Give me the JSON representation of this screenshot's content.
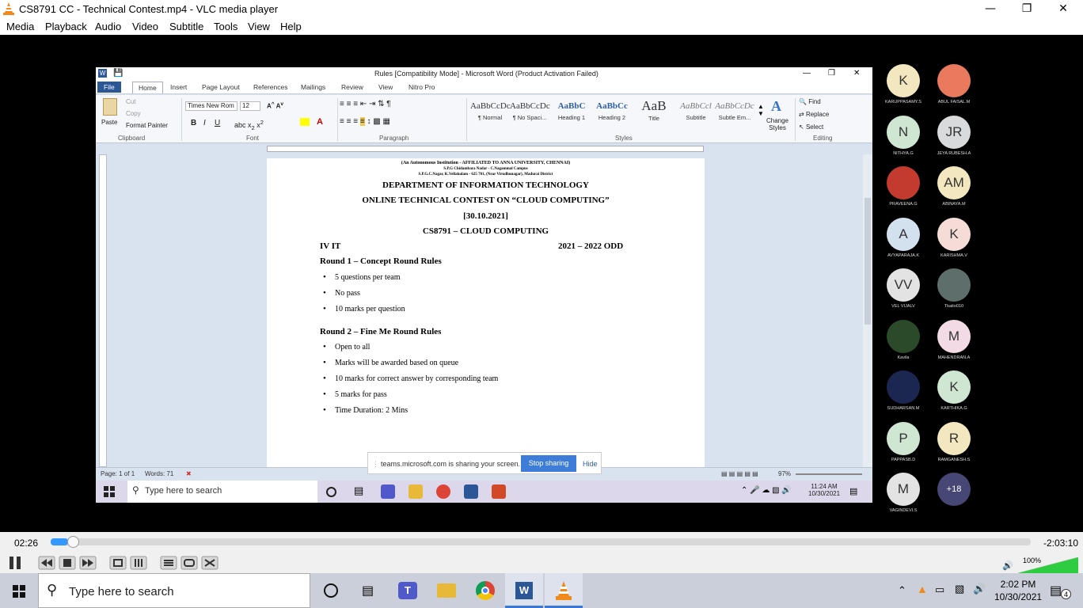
{
  "vlc": {
    "title": "CS8791 CC - Technical Contest.mp4 - VLC media player",
    "menu": [
      "Media",
      "Playback",
      "Audio",
      "Video",
      "Subtitle",
      "Tools",
      "View",
      "Help"
    ],
    "time_elapsed": "02:26",
    "time_remaining": "-2:03:10",
    "progress": 0.018,
    "volume_label": "100%",
    "volume": 1.0
  },
  "word": {
    "title": "Rules [Compatibility Mode] - Microsoft Word (Product Activation Failed)",
    "tabs": [
      "File",
      "Home",
      "Insert",
      "Page Layout",
      "References",
      "Mailings",
      "Review",
      "View",
      "Nitro Pro"
    ],
    "clipboard": {
      "paste": "Paste",
      "cut": "Cut",
      "copy": "Copy",
      "format_painter": "Format Painter",
      "group": "Clipboard"
    },
    "font": {
      "name": "Times New Rom",
      "size": "12",
      "group": "Font"
    },
    "paragraph_group": "Paragraph",
    "styles": [
      {
        "preview": "AaBbCcDc",
        "name": "¶ Normal"
      },
      {
        "preview": "AaBbCcDc",
        "name": "¶ No Spaci..."
      },
      {
        "preview": "AaBbC",
        "name": "Heading 1"
      },
      {
        "preview": "AaBbCc",
        "name": "Heading 2"
      },
      {
        "preview": "AaB",
        "name": "Title"
      },
      {
        "preview": "AaBbCcl",
        "name": "Subtitle"
      },
      {
        "preview": "AaBbCcDc",
        "name": "Subtle Em..."
      }
    ],
    "styles_group": "Styles",
    "change_styles": "Change Styles",
    "editing": {
      "find": "Find",
      "replace": "Replace",
      "select": "Select",
      "group": "Editing"
    },
    "doc": {
      "header_line1": "(An Autonomous Institution - AFFILIATED TO ANNA UNIVERSITY, CHENNAI)",
      "header_line2": "S.P.G Chidambara Nadar - C.Nagammal Campus",
      "header_line3": "S.P.G.C.Nagar, K.Vellakulam - 625 701, (Near Virudhunagar), Madurai District",
      "title1": "DEPARTMENT OF INFORMATION TECHNOLOGY",
      "title2": "ONLINE TECHNICAL CONTEST ON “CLOUD COMPUTING”",
      "date": "[30.10.2021]",
      "course": "CS8791 – CLOUD COMPUTING",
      "year": "IV IT",
      "semester": "2021 – 2022 ODD",
      "round1_heading": "Round 1 – Concept Round Rules",
      "round1_rules": [
        "5 questions per team",
        "No pass",
        "10 marks per question"
      ],
      "round2_heading": "Round 2 – Fine Me Round Rules",
      "round2_rules": [
        "Open to all",
        "Marks will  be awarded based on queue",
        "10 marks for correct answer by corresponding team",
        "5 marks for pass",
        "Time  Duration:  2 Mins"
      ]
    },
    "status": {
      "page": "Page: 1 of 1",
      "words": "Words: 71",
      "zoom": "97%"
    }
  },
  "share_bar": {
    "text": "teams.microsoft.com is sharing your screen.",
    "stop": "Stop sharing",
    "hide": "Hide"
  },
  "inner_taskbar": {
    "search_placeholder": "Type here to search",
    "time": "11:24 AM",
    "date": "10/30/2021"
  },
  "participants": [
    {
      "initials": "K",
      "name": "KARUPPASAMY.S",
      "color": "#f3e7bf"
    },
    {
      "initials": "",
      "name": "ABUL FAISAL.M",
      "color": "#e97a5d"
    },
    {
      "initials": "N",
      "name": "NITHYA.G",
      "color": "#cfe6d2"
    },
    {
      "initials": "JR",
      "name": "JEYA RUBESH.A",
      "color": "#d9dadc"
    },
    {
      "initials": "",
      "name": "PRAVEENA.G",
      "color": "#c33b2f"
    },
    {
      "initials": "AM",
      "name": "ABINAYA.M",
      "color": "#f3e7bf"
    },
    {
      "initials": "A",
      "name": "AVYAPARAJA.K",
      "color": "#d3e1ef"
    },
    {
      "initials": "K",
      "name": "KARISHMA.V",
      "color": "#f6dcd6"
    },
    {
      "initials": "VV",
      "name": "VEL VIJALV",
      "color": "#e3e3e3"
    },
    {
      "initials": "",
      "name": "Tkaito010",
      "color": "#5e6e6a"
    },
    {
      "initials": "",
      "name": "Kavila",
      "color": "#2b4a2a"
    },
    {
      "initials": "M",
      "name": "MAHENDRAN.A",
      "color": "#f3dbe6"
    },
    {
      "initials": "",
      "name": "SUDHARSAN.M",
      "color": "#1b2750"
    },
    {
      "initials": "K",
      "name": "KARTHIKA.G",
      "color": "#cfe6d2"
    },
    {
      "initials": "P",
      "name": "PAPPASB.D",
      "color": "#cfe6d2"
    },
    {
      "initials": "R",
      "name": "RAMGANESH.S",
      "color": "#f3e7bf"
    },
    {
      "initials": "M",
      "name": "VAGINDEVI.S",
      "color": "#e3e3e3"
    },
    {
      "initials": "+18",
      "name": "",
      "color": "#464775"
    }
  ],
  "taskbar": {
    "search_placeholder": "Type here to search",
    "time": "2:02 PM",
    "date": "10/30/2021",
    "notifications": "4"
  }
}
